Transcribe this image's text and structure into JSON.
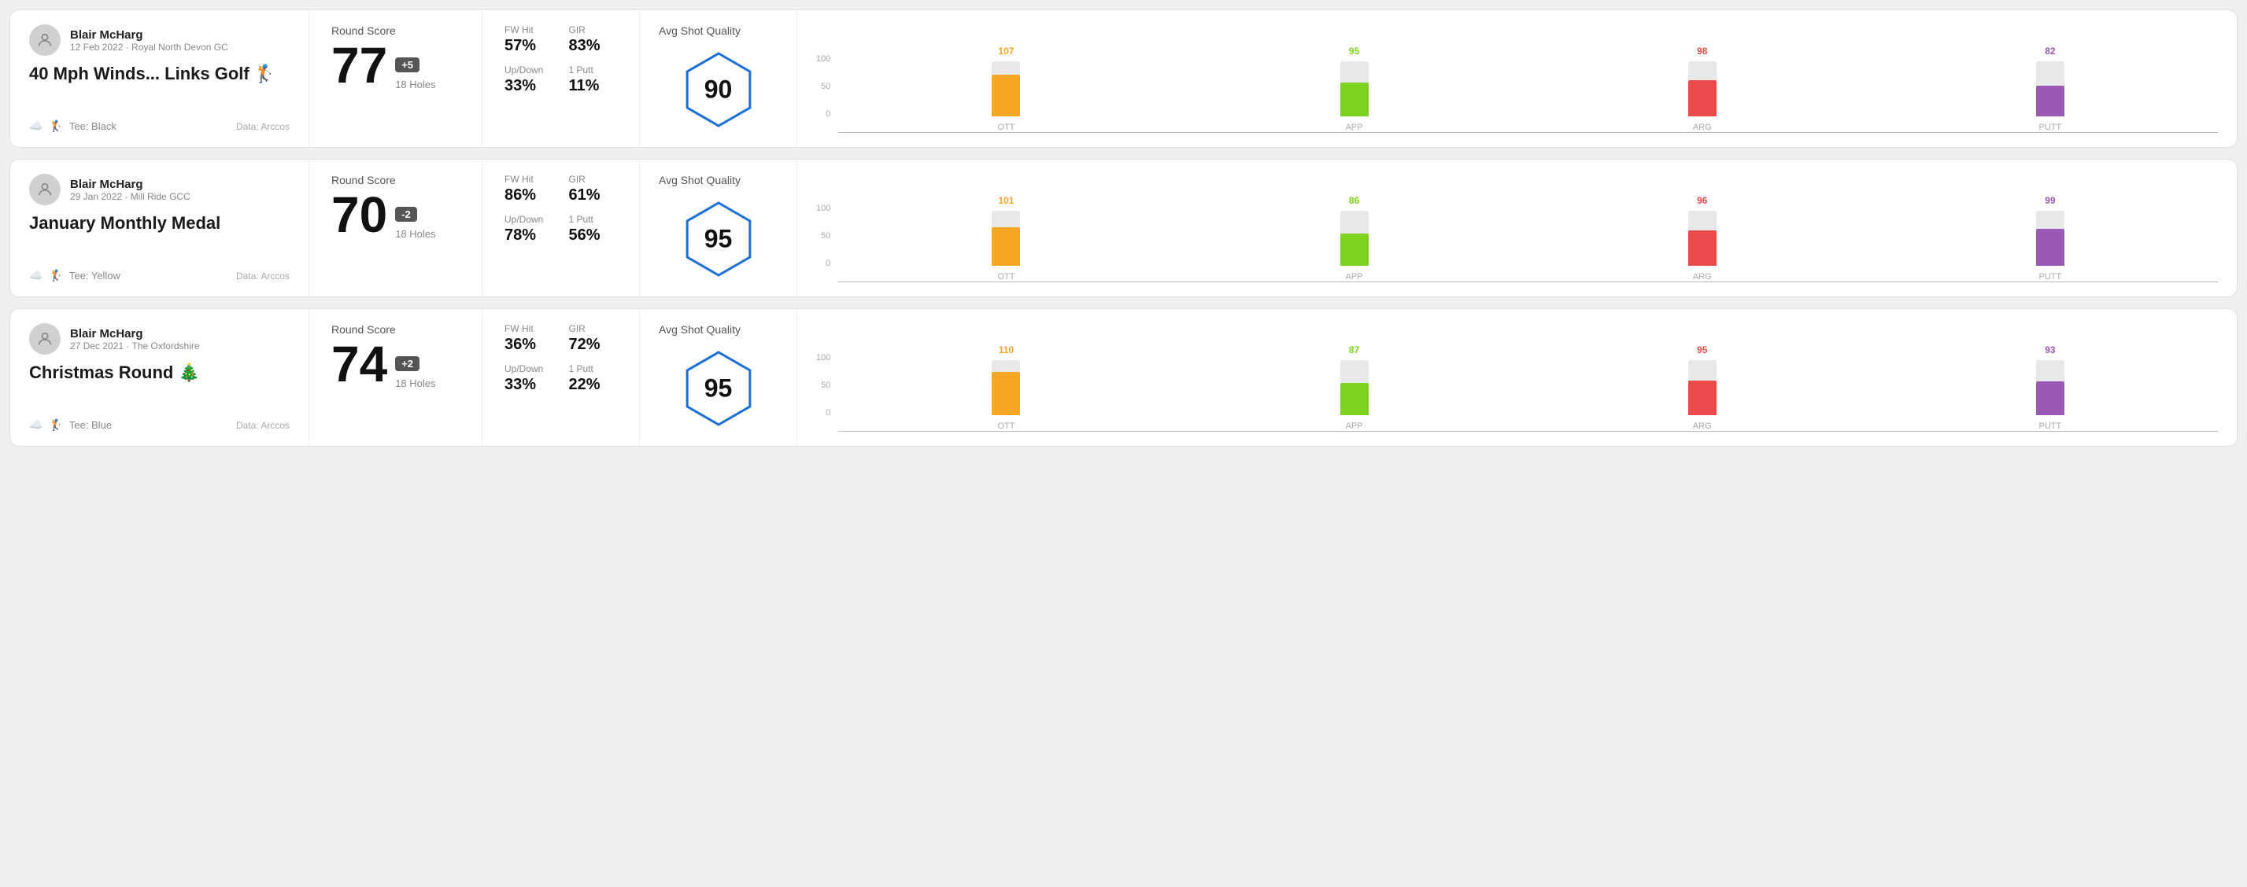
{
  "rounds": [
    {
      "id": "round1",
      "user": {
        "name": "Blair McHarg",
        "date": "12 Feb 2022 · Royal North Devon GC"
      },
      "title": "40 Mph Winds... Links Golf 🏌️",
      "tee": "Black",
      "data_source": "Data: Arccos",
      "score": {
        "value": "77",
        "badge": "+5",
        "holes": "18 Holes"
      },
      "stats": {
        "fw_hit_label": "FW Hit",
        "fw_hit_value": "57%",
        "gir_label": "GIR",
        "gir_value": "83%",
        "up_down_label": "Up/Down",
        "up_down_value": "33%",
        "one_putt_label": "1 Putt",
        "one_putt_value": "11%"
      },
      "quality": {
        "label": "Avg Shot Quality",
        "value": "90"
      },
      "chart": {
        "ott": {
          "value": 107,
          "bar_pct": 75
        },
        "app": {
          "value": 95,
          "bar_pct": 62
        },
        "arg": {
          "value": 98,
          "bar_pct": 65
        },
        "putt": {
          "value": 82,
          "bar_pct": 55
        }
      }
    },
    {
      "id": "round2",
      "user": {
        "name": "Blair McHarg",
        "date": "29 Jan 2022 · Mill Ride GCC"
      },
      "title": "January Monthly Medal",
      "tee": "Yellow",
      "data_source": "Data: Arccos",
      "score": {
        "value": "70",
        "badge": "-2",
        "holes": "18 Holes"
      },
      "stats": {
        "fw_hit_label": "FW Hit",
        "fw_hit_value": "86%",
        "gir_label": "GIR",
        "gir_value": "61%",
        "up_down_label": "Up/Down",
        "up_down_value": "78%",
        "one_putt_label": "1 Putt",
        "one_putt_value": "56%"
      },
      "quality": {
        "label": "Avg Shot Quality",
        "value": "95"
      },
      "chart": {
        "ott": {
          "value": 101,
          "bar_pct": 70
        },
        "app": {
          "value": 86,
          "bar_pct": 58
        },
        "arg": {
          "value": 96,
          "bar_pct": 64
        },
        "putt": {
          "value": 99,
          "bar_pct": 67
        }
      }
    },
    {
      "id": "round3",
      "user": {
        "name": "Blair McHarg",
        "date": "27 Dec 2021 · The Oxfordshire"
      },
      "title": "Christmas Round 🎄",
      "tee": "Blue",
      "data_source": "Data: Arccos",
      "score": {
        "value": "74",
        "badge": "+2",
        "holes": "18 Holes"
      },
      "stats": {
        "fw_hit_label": "FW Hit",
        "fw_hit_value": "36%",
        "gir_label": "GIR",
        "gir_value": "72%",
        "up_down_label": "Up/Down",
        "up_down_value": "33%",
        "one_putt_label": "1 Putt",
        "one_putt_value": "22%"
      },
      "quality": {
        "label": "Avg Shot Quality",
        "value": "95"
      },
      "chart": {
        "ott": {
          "value": 110,
          "bar_pct": 78
        },
        "app": {
          "value": 87,
          "bar_pct": 58
        },
        "arg": {
          "value": 95,
          "bar_pct": 63
        },
        "putt": {
          "value": 93,
          "bar_pct": 62
        }
      }
    }
  ],
  "chart_y_labels": [
    "100",
    "50",
    "0"
  ],
  "chart_bar_labels": [
    "OTT",
    "APP",
    "ARG",
    "PUTT"
  ]
}
